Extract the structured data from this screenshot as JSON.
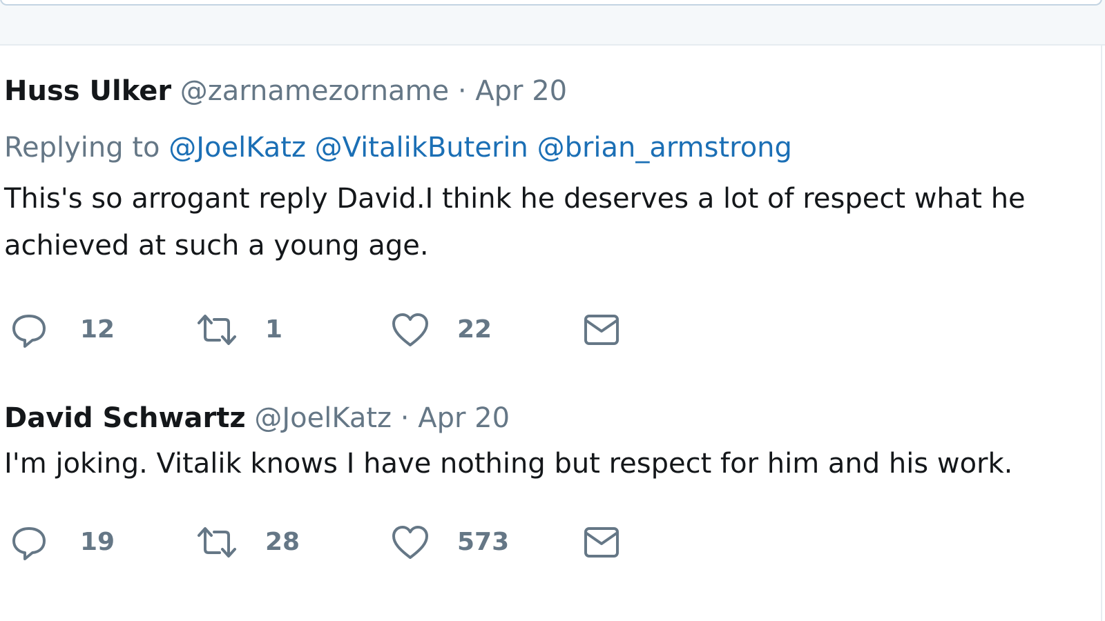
{
  "tweets": [
    {
      "name": "Huss Ulker",
      "handle": "@zarnamezorname",
      "separator": "·",
      "date": "Apr 20",
      "replying_prefix": "Replying to",
      "mentions": [
        "@JoelKatz",
        "@VitalikButerin",
        "@brian_armstrong"
      ],
      "text": "This's so arrogant reply David.I think he deserves a lot of respect what he achieved at such a young age.",
      "actions": {
        "reply_count": "12",
        "retweet_count": "1",
        "like_count": "22"
      }
    },
    {
      "name": "David Schwartz",
      "handle": "@JoelKatz",
      "separator": "·",
      "date": "Apr 20",
      "text": "I'm joking. Vitalik knows I have nothing but respect for him and his work.",
      "actions": {
        "reply_count": "19",
        "retweet_count": "28",
        "like_count": "573"
      }
    }
  ],
  "icons": {
    "reply": "reply-icon",
    "retweet": "retweet-icon",
    "like": "heart-icon",
    "dm": "envelope-icon"
  },
  "colors": {
    "text": "#14171a",
    "muted": "#657786",
    "mention": "#1b6fb5",
    "divider": "#e6ecf0"
  }
}
